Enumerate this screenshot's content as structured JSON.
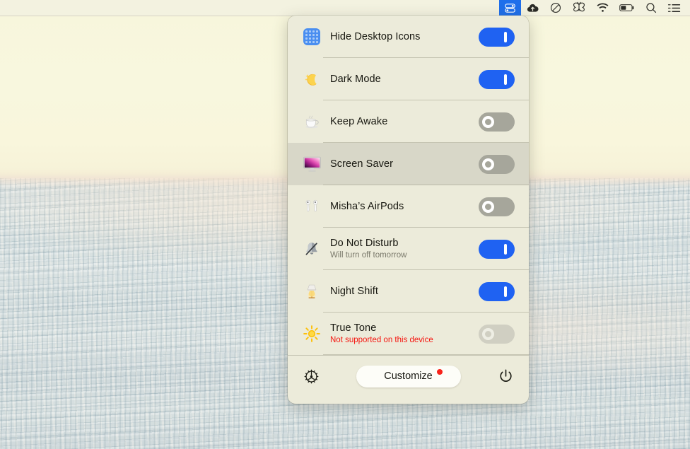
{
  "menubar": {
    "items": [
      {
        "name": "one-switch-toggles-icon",
        "glyph": "toggles",
        "active": true
      },
      {
        "name": "cloud-upload-icon",
        "glyph": "cloud",
        "active": false
      },
      {
        "name": "circle-slash-icon",
        "glyph": "slash",
        "active": false
      },
      {
        "name": "butterfly-icon",
        "glyph": "butterfly",
        "active": false
      },
      {
        "name": "wifi-icon",
        "glyph": "wifi",
        "active": false
      },
      {
        "name": "battery-icon",
        "glyph": "battery",
        "active": false
      },
      {
        "name": "spotlight-search-icon",
        "glyph": "search",
        "active": false
      },
      {
        "name": "control-center-icon",
        "glyph": "list",
        "active": false
      }
    ]
  },
  "panel": {
    "rows": [
      {
        "id": "hide-desktop-icons",
        "icon": "desktop-grid-icon",
        "emoji": "",
        "title": "Hide Desktop Icons",
        "subtitle": "",
        "state": "on",
        "highlight": false
      },
      {
        "id": "dark-mode",
        "icon": "crescent-moon-icon",
        "emoji": "🌙",
        "title": "Dark Mode",
        "subtitle": "",
        "state": "on",
        "highlight": false
      },
      {
        "id": "keep-awake",
        "icon": "coffee-cup-icon",
        "emoji": "☕",
        "title": "Keep Awake",
        "subtitle": "",
        "state": "off",
        "highlight": false
      },
      {
        "id": "screen-saver",
        "icon": "display-icon",
        "emoji": "🖥",
        "title": "Screen Saver",
        "subtitle": "",
        "state": "off",
        "highlight": true
      },
      {
        "id": "airpods",
        "icon": "airpods-icon",
        "emoji": "🎧",
        "title": "Misha’s AirPods",
        "subtitle": "",
        "state": "off",
        "highlight": false
      },
      {
        "id": "do-not-disturb",
        "icon": "bell-slash-icon",
        "emoji": "🔕",
        "title": "Do Not Disturb",
        "subtitle": "Will turn off tomorrow",
        "state": "on",
        "highlight": false
      },
      {
        "id": "night-shift",
        "icon": "lamp-icon",
        "emoji": "💡",
        "title": "Night Shift",
        "subtitle": "",
        "state": "on",
        "highlight": false
      },
      {
        "id": "true-tone",
        "icon": "sun-icon",
        "emoji": "☀",
        "title": "True Tone",
        "subtitle": "Not supported on this device",
        "subtitle_style": "warn",
        "state": "disabled",
        "highlight": false
      }
    ],
    "footer": {
      "settings_icon": "gear-icon",
      "customize_label": "Customize",
      "customize_badge": true,
      "power_icon": "power-icon"
    }
  }
}
